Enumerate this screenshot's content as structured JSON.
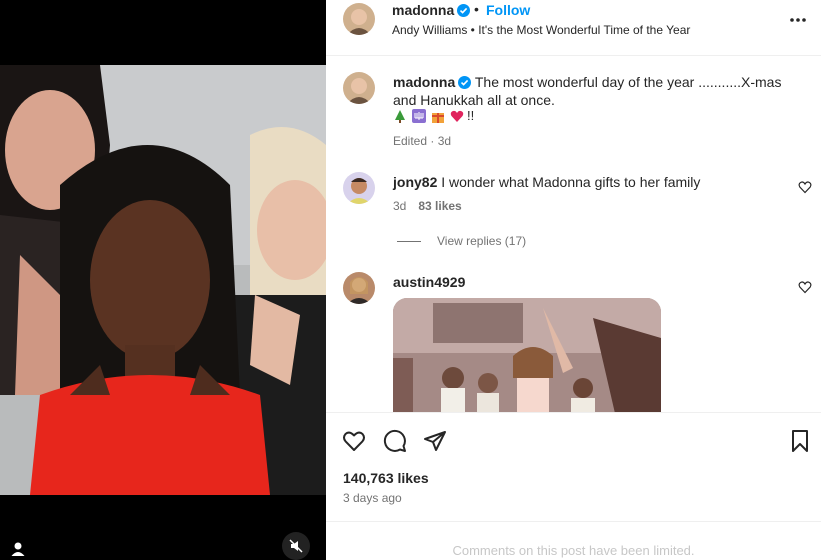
{
  "post": {
    "username": "madonna",
    "separator": "•",
    "follow_label": "Follow",
    "audio": "Andy Williams • It's the Most Wonderful Time of the Year"
  },
  "caption": {
    "username": "madonna",
    "text": "The most wonderful day of the year ...........X-mas and Hanukkah all at once.",
    "emoji_suffix": "!!",
    "meta": "Edited · 3d",
    "emojis": [
      "christmas-tree-icon",
      "menorah-icon",
      "gift-icon",
      "heart-icon"
    ]
  },
  "comments": [
    {
      "username": "jony82",
      "text": "I wonder what Madonna gifts to her family",
      "age": "3d",
      "likes": "83 likes",
      "view_replies": "View replies (17)"
    },
    {
      "username": "austin4929"
    }
  ],
  "stats": {
    "likes": "140,763 likes",
    "date": "3 days ago"
  },
  "footer": {
    "limited": "Comments on this post have been limited."
  },
  "colors": {
    "accent": "#0095f6",
    "verified": "#0095f6",
    "text": "#262626",
    "secondary": "#737373",
    "divider": "#efefef"
  }
}
